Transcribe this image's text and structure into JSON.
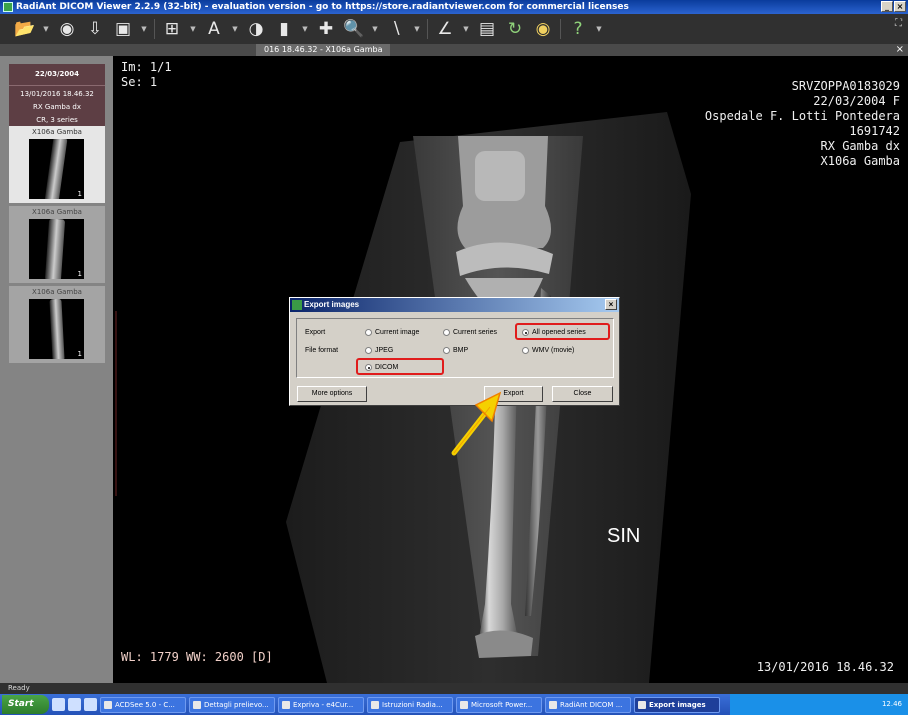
{
  "window": {
    "title": "RadiAnt DICOM Viewer 2.2.9 (32-bit) - evaluation version - go to https://store.radiantviewer.com for commercial licenses",
    "controls": [
      "_",
      "×"
    ]
  },
  "tab": {
    "label": "016 18.46.32 - X106a Gamba",
    "close": "×"
  },
  "sidebar": {
    "study": {
      "date": "22/03/2004",
      "info": [
        "13/01/2016 18.46.32",
        "RX Gamba dx",
        "CR, 3 series"
      ]
    },
    "series": [
      {
        "label": "X106a Gamba",
        "num": "1"
      },
      {
        "label": "X106a Gamba",
        "num": "1"
      },
      {
        "label": "X106a Gamba",
        "num": "1"
      }
    ]
  },
  "overlay": {
    "top_left": [
      "Im: 1/1",
      "Se: 1"
    ],
    "top_right": [
      "SRVZOPPA0183029",
      "22/03/2004 F",
      "Ospedale F. Lotti Pontedera",
      "1691742",
      "RX Gamba dx",
      "X106a Gamba"
    ],
    "bottom_left": "WL: 1779 WW: 2600 [D]",
    "bottom_right": "13/01/2016 18.46.32",
    "side_marker": "SIN"
  },
  "dialog": {
    "title": "Export images",
    "close": "×",
    "export_label": "Export",
    "format_label": "File format",
    "export_options": [
      "Current image",
      "Current series",
      "All opened series"
    ],
    "format_options": [
      "JPEG",
      "BMP",
      "WMV (movie)",
      "DICOM"
    ],
    "selected_export": "All opened series",
    "selected_format": "DICOM",
    "buttons": {
      "more": "More options",
      "export": "Export",
      "close": "Close"
    }
  },
  "statusbar": {
    "text": "Ready"
  },
  "taskbar": {
    "start": "Start",
    "tasks": [
      "ACDSee 5.0 - C...",
      "Dettagli prelievo...",
      "Expriva - e4Cur...",
      "Istruzioni Radia...",
      "Microsoft Power...",
      "RadiAnt DICOM ...",
      "Export images"
    ],
    "active_task": "Export images",
    "clock": "12.46"
  },
  "colors": {
    "highlight": "#e01c1c",
    "arrow": "#f5d000",
    "titlebar": "#0a3c9c"
  }
}
